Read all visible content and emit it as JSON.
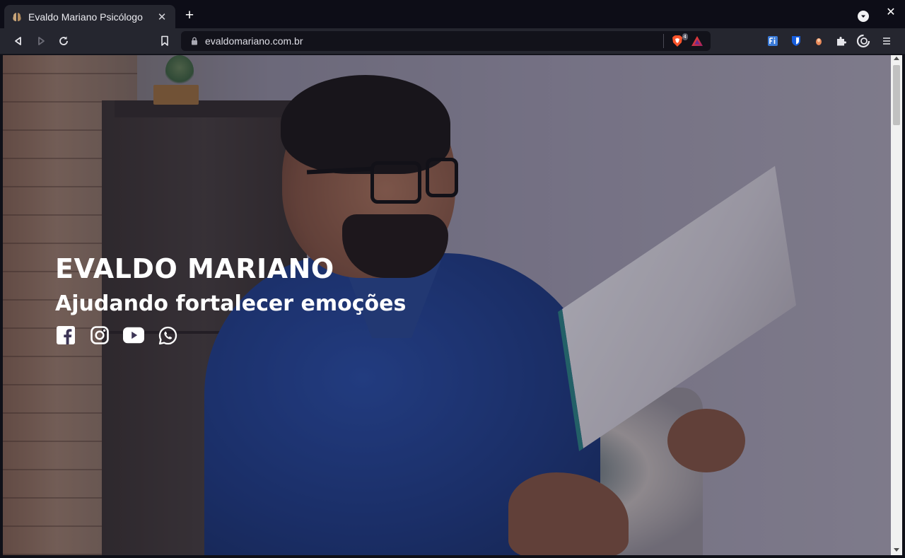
{
  "browser": {
    "tab": {
      "title": "Evaldo Mariano Psicólogo",
      "favicon": "brain-icon",
      "close_glyph": "✕"
    },
    "new_tab_glyph": "+",
    "window_close_glyph": "✕",
    "url": "evaldomariano.com.br",
    "shield_count": "4",
    "toolbar_icons": [
      "back-icon",
      "forward-icon",
      "reload-icon",
      "bookmark-icon",
      "lock-icon",
      "brave-shield-icon",
      "brave-rewards-icon"
    ],
    "extensions": [
      "fi-extension-icon",
      "bitwarden-icon",
      "extension-dot-icon",
      "puzzle-icon",
      "profile-icon",
      "menu-icon"
    ]
  },
  "hero": {
    "name": "EVALDO MARIANO",
    "tagline": "Ajudando fortalecer emoções",
    "socials": [
      "facebook-icon",
      "instagram-icon",
      "youtube-icon",
      "whatsapp-icon"
    ]
  },
  "colors": {
    "chrome_dark": "#0d0d17",
    "toolbar": "#25262f",
    "hero_text": "#ffffff",
    "brave_orange": "#fb542b"
  }
}
